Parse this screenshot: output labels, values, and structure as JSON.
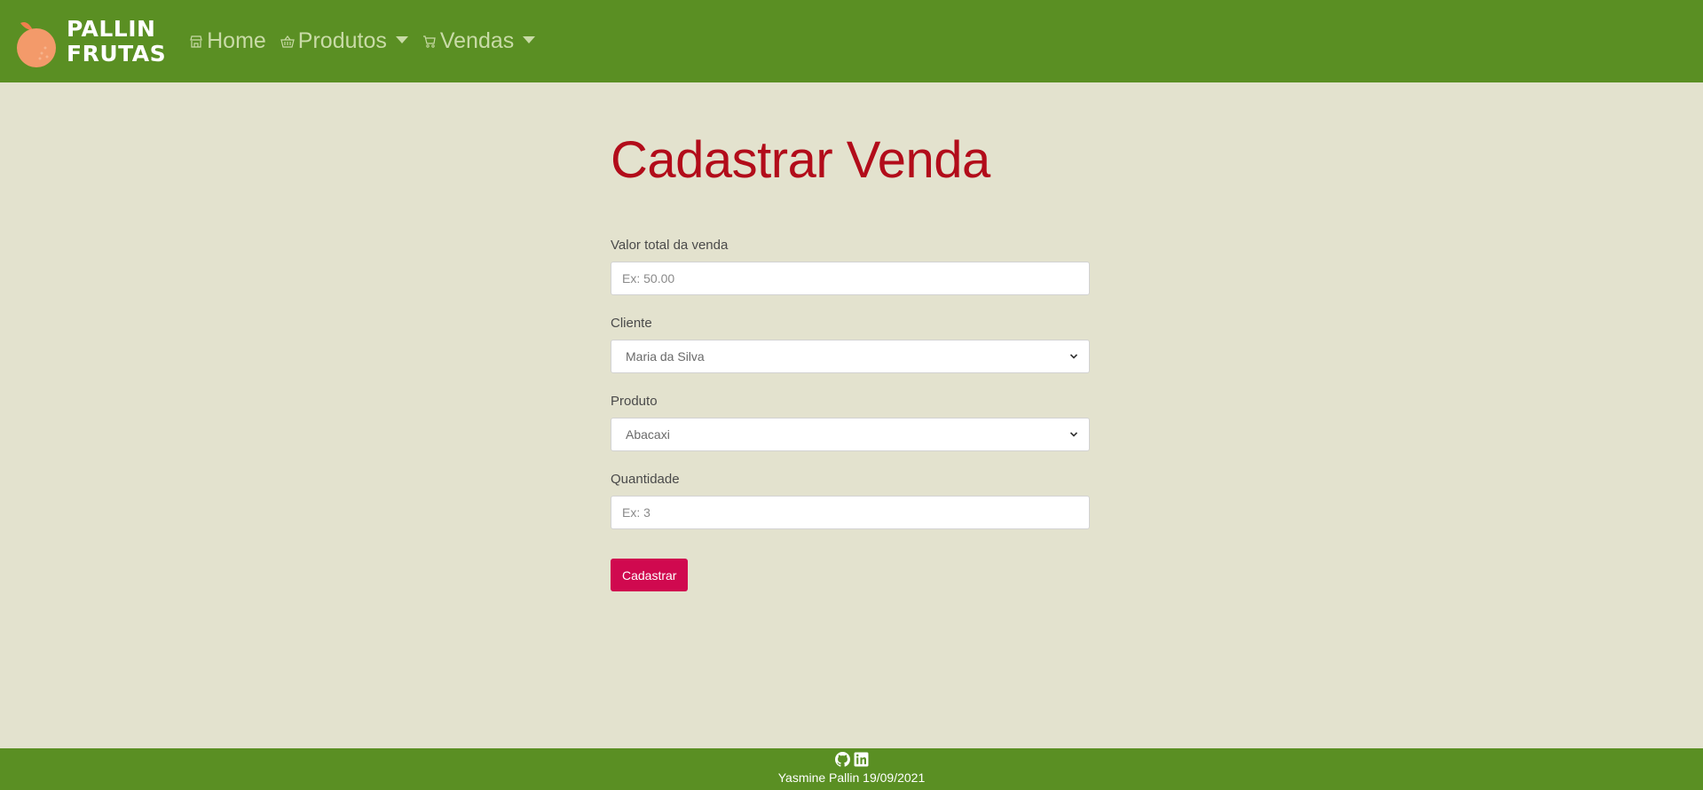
{
  "navbar": {
    "brand_line1": "PALLIN",
    "brand_line2": "FRUTAS",
    "logo_icon": "orange-fruit-icon",
    "items": [
      {
        "label": "Home",
        "icon": "store-icon",
        "dropdown": false
      },
      {
        "label": "Produtos",
        "icon": "basket-icon",
        "dropdown": true
      },
      {
        "label": "Vendas",
        "icon": "cart-icon",
        "dropdown": true
      }
    ],
    "bg_color": "#5a8f23"
  },
  "main": {
    "title": "Cadastrar Venda",
    "title_color": "#b20c1a",
    "form": {
      "valor_label": "Valor total da venda",
      "valor_placeholder": "Ex: 50.00",
      "cliente_label": "Cliente",
      "cliente_value": "Maria da Silva",
      "produto_label": "Produto",
      "produto_value": "Abacaxi",
      "quantidade_label": "Quantidade",
      "quantidade_placeholder": "Ex: 3",
      "submit_label": "Cadastrar",
      "submit_color": "#d0094f"
    }
  },
  "footer": {
    "icons": [
      "github-icon",
      "linkedin-icon"
    ],
    "text": "Yasmine Pallin 19/09/2021"
  }
}
